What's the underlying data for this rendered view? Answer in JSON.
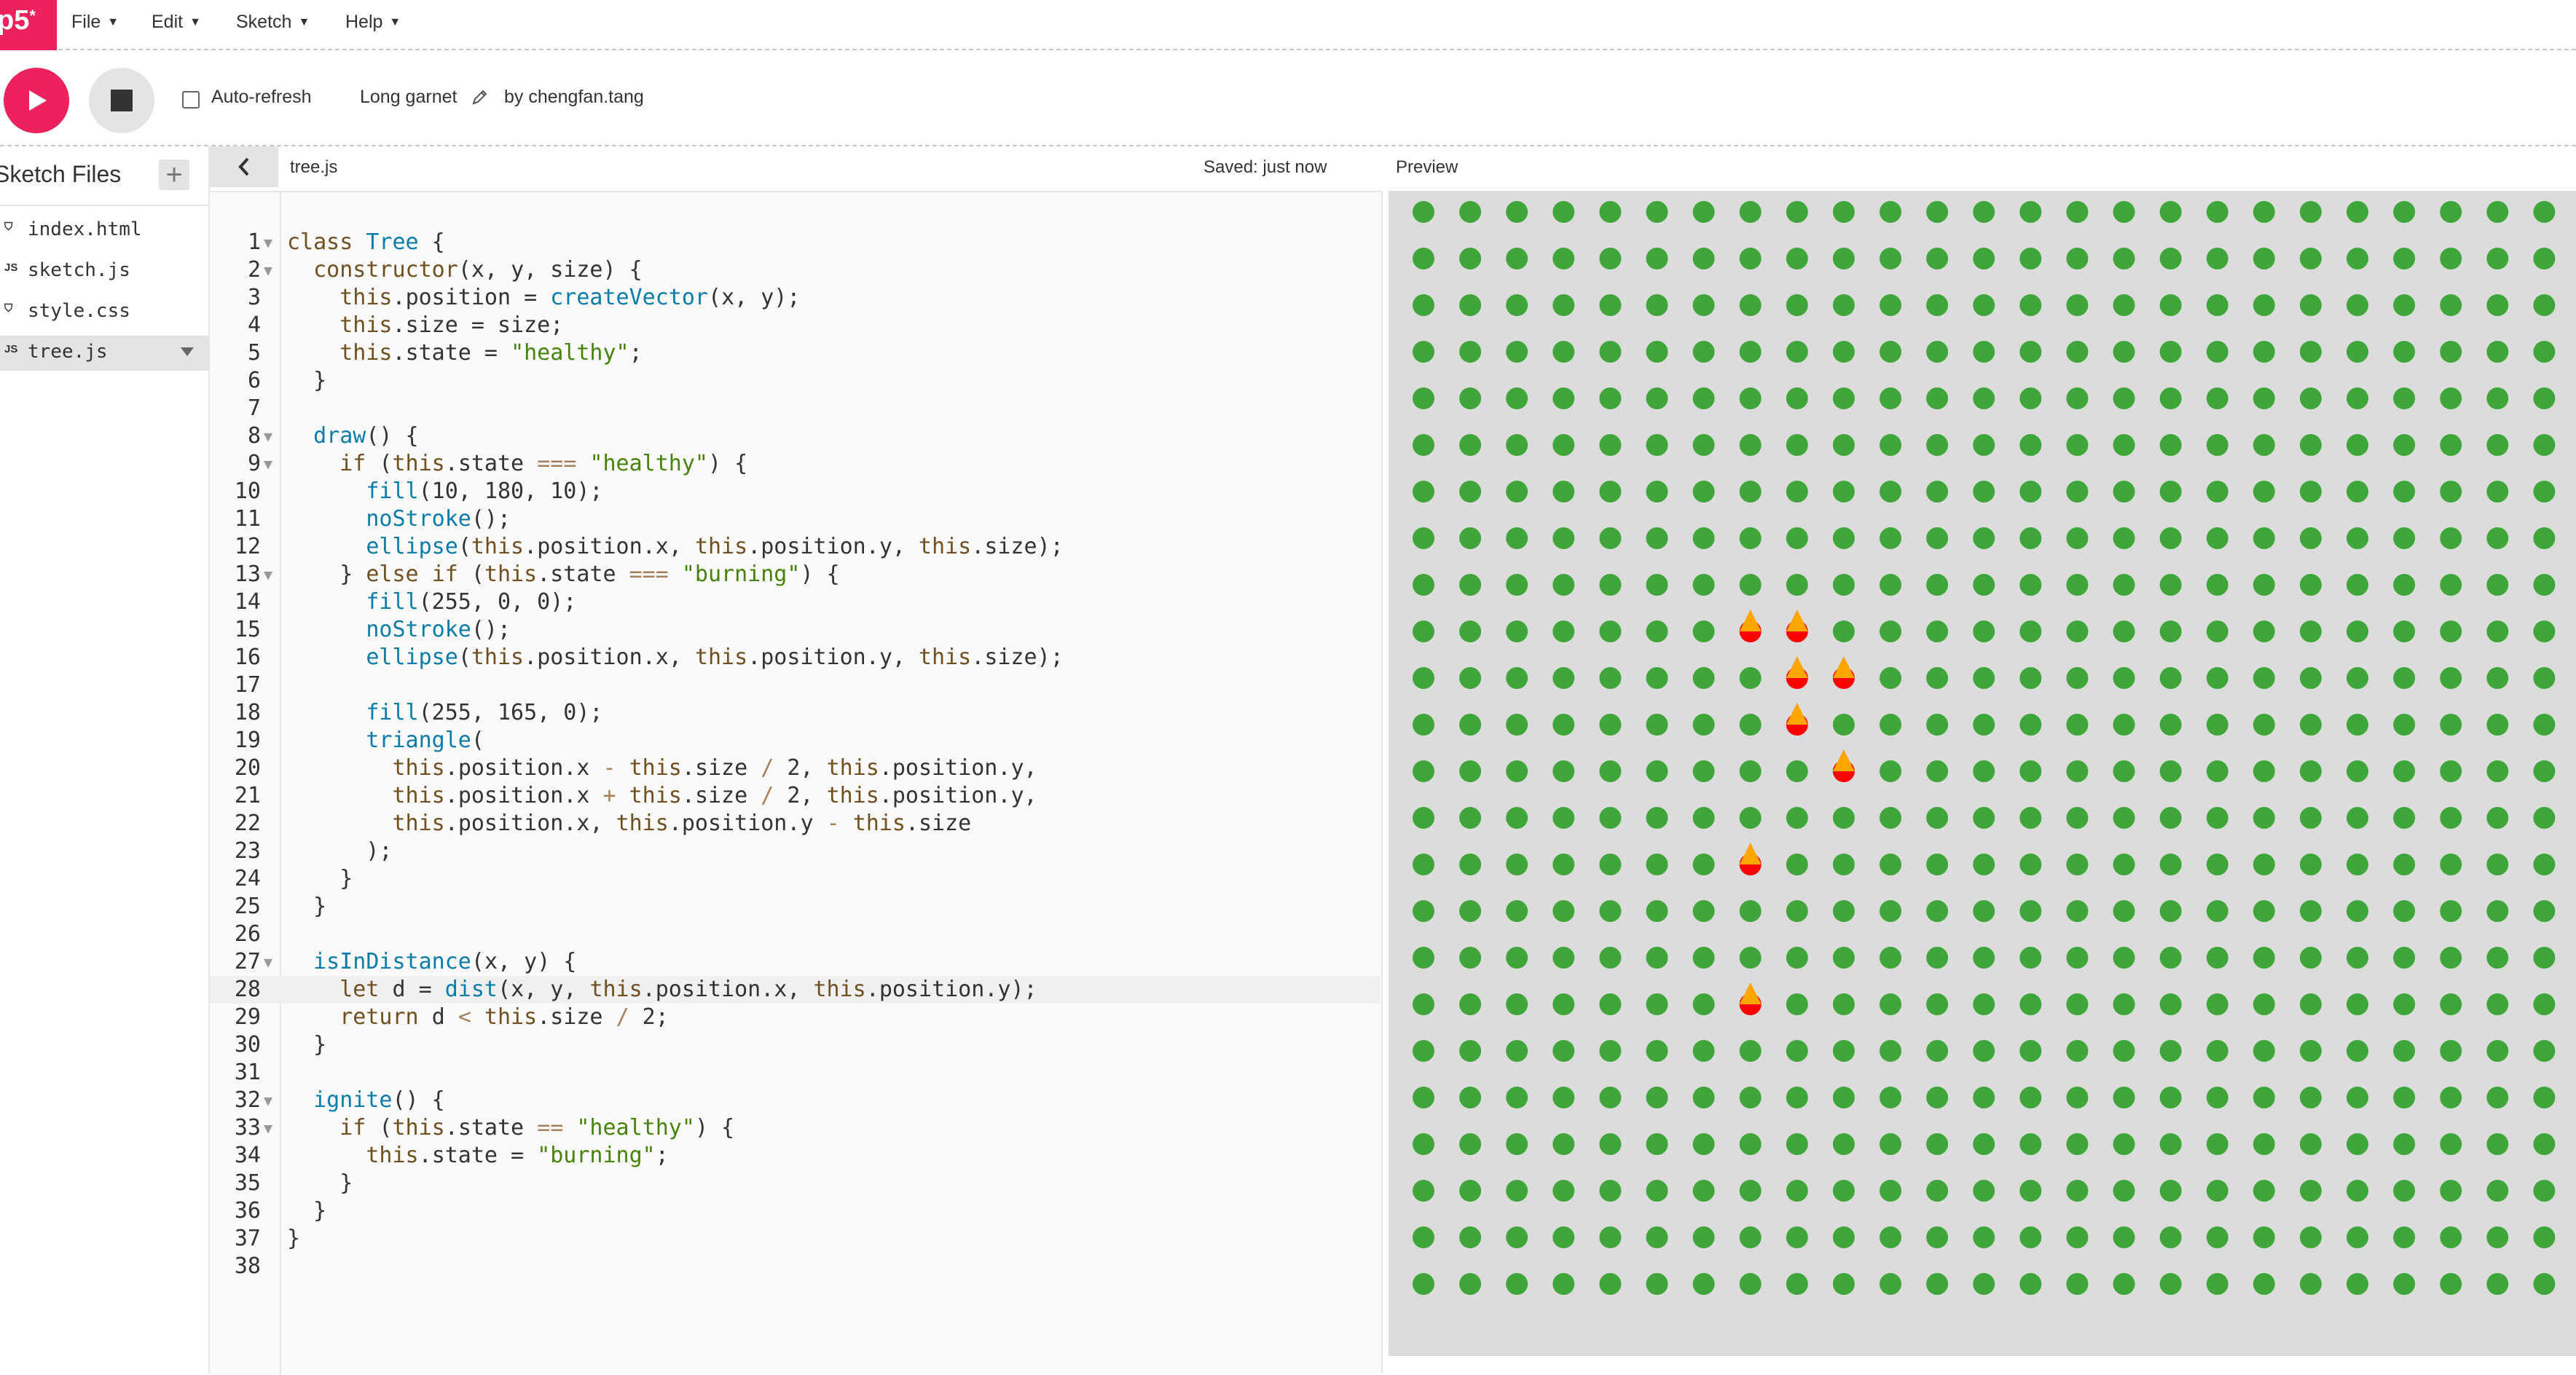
{
  "menubar": {
    "logo_text": "p5",
    "logo_star": "*",
    "items": [
      {
        "label": "File"
      },
      {
        "label": "Edit"
      },
      {
        "label": "Sketch"
      },
      {
        "label": "Help"
      }
    ]
  },
  "toolbar": {
    "play_icon": "play-icon",
    "stop_icon": "stop-icon",
    "autorefresh_label": "Auto-refresh",
    "autorefresh_checked": false,
    "sketch_name": "Long garnet",
    "edit_icon": "pencil-icon",
    "author": "by chengfan.tang"
  },
  "sidebar": {
    "title": "Sketch Files",
    "add_icon": "plus-icon",
    "files": [
      {
        "icon": "html-file-icon",
        "badge": "⛉",
        "name": "index.html",
        "selected": false
      },
      {
        "icon": "js-file-icon",
        "badge": "JS",
        "name": "sketch.js",
        "selected": false
      },
      {
        "icon": "css-file-icon",
        "badge": "⛉",
        "name": "style.css",
        "selected": false
      },
      {
        "icon": "js-file-icon",
        "badge": "JS",
        "name": "tree.js",
        "selected": true
      }
    ]
  },
  "editor": {
    "filename": "tree.js",
    "saved_status": "Saved: just now",
    "active_line": 28,
    "lines": [
      {
        "n": "1",
        "fold": true,
        "text": "class Tree {"
      },
      {
        "n": "2",
        "fold": true,
        "text": "  constructor(x, y, size) {"
      },
      {
        "n": "3",
        "fold": false,
        "text": "    this.position = createVector(x, y);"
      },
      {
        "n": "4",
        "fold": false,
        "text": "    this.size = size;"
      },
      {
        "n": "5",
        "fold": false,
        "text": "    this.state = \"healthy\";"
      },
      {
        "n": "6",
        "fold": false,
        "text": "  }"
      },
      {
        "n": "7",
        "fold": false,
        "text": ""
      },
      {
        "n": "8",
        "fold": true,
        "text": "  draw() {"
      },
      {
        "n": "9",
        "fold": true,
        "text": "    if (this.state === \"healthy\") {"
      },
      {
        "n": "10",
        "fold": false,
        "text": "      fill(10, 180, 10);"
      },
      {
        "n": "11",
        "fold": false,
        "text": "      noStroke();"
      },
      {
        "n": "12",
        "fold": false,
        "text": "      ellipse(this.position.x, this.position.y, this.size);"
      },
      {
        "n": "13",
        "fold": true,
        "text": "    } else if (this.state === \"burning\") {"
      },
      {
        "n": "14",
        "fold": false,
        "text": "      fill(255, 0, 0);"
      },
      {
        "n": "15",
        "fold": false,
        "text": "      noStroke();"
      },
      {
        "n": "16",
        "fold": false,
        "text": "      ellipse(this.position.x, this.position.y, this.size);"
      },
      {
        "n": "17",
        "fold": false,
        "text": ""
      },
      {
        "n": "18",
        "fold": false,
        "text": "      fill(255, 165, 0);"
      },
      {
        "n": "19",
        "fold": false,
        "text": "      triangle("
      },
      {
        "n": "20",
        "fold": false,
        "text": "        this.position.x - this.size / 2, this.position.y,"
      },
      {
        "n": "21",
        "fold": false,
        "text": "        this.position.x + this.size / 2, this.position.y,"
      },
      {
        "n": "22",
        "fold": false,
        "text": "        this.position.x, this.position.y - this.size"
      },
      {
        "n": "23",
        "fold": false,
        "text": "      );"
      },
      {
        "n": "24",
        "fold": false,
        "text": "    }"
      },
      {
        "n": "25",
        "fold": false,
        "text": "  }"
      },
      {
        "n": "26",
        "fold": false,
        "text": ""
      },
      {
        "n": "27",
        "fold": true,
        "text": "  isInDistance(x, y) {"
      },
      {
        "n": "28",
        "fold": false,
        "text": "    let d = dist(x, y, this.position.x, this.position.y);"
      },
      {
        "n": "29",
        "fold": false,
        "text": "    return d < this.size / 2;"
      },
      {
        "n": "30",
        "fold": false,
        "text": "  }"
      },
      {
        "n": "31",
        "fold": false,
        "text": ""
      },
      {
        "n": "32",
        "fold": true,
        "text": "  ignite() {"
      },
      {
        "n": "33",
        "fold": true,
        "text": "    if (this.state == \"healthy\") {"
      },
      {
        "n": "34",
        "fold": false,
        "text": "      this.state = \"burning\";"
      },
      {
        "n": "35",
        "fold": false,
        "text": "    }"
      },
      {
        "n": "36",
        "fold": false,
        "text": "  }"
      },
      {
        "n": "37",
        "fold": false,
        "text": "}"
      },
      {
        "n": "38",
        "fold": false,
        "text": ""
      }
    ]
  },
  "preview": {
    "label": "Preview",
    "canvas_background": "#dcdcdc",
    "healthy_color": "#3fa63a",
    "burning_color": "#ff0000",
    "flame_color": "#ffa500",
    "grid_cols": 25,
    "grid_rows": 24,
    "burning_trees": [
      {
        "row": 9,
        "col": 7
      },
      {
        "row": 9,
        "col": 8
      },
      {
        "row": 10,
        "col": 8
      },
      {
        "row": 10,
        "col": 9
      },
      {
        "row": 11,
        "col": 8
      },
      {
        "row": 12,
        "col": 9
      },
      {
        "row": 14,
        "col": 7
      },
      {
        "row": 17,
        "col": 7
      }
    ]
  }
}
